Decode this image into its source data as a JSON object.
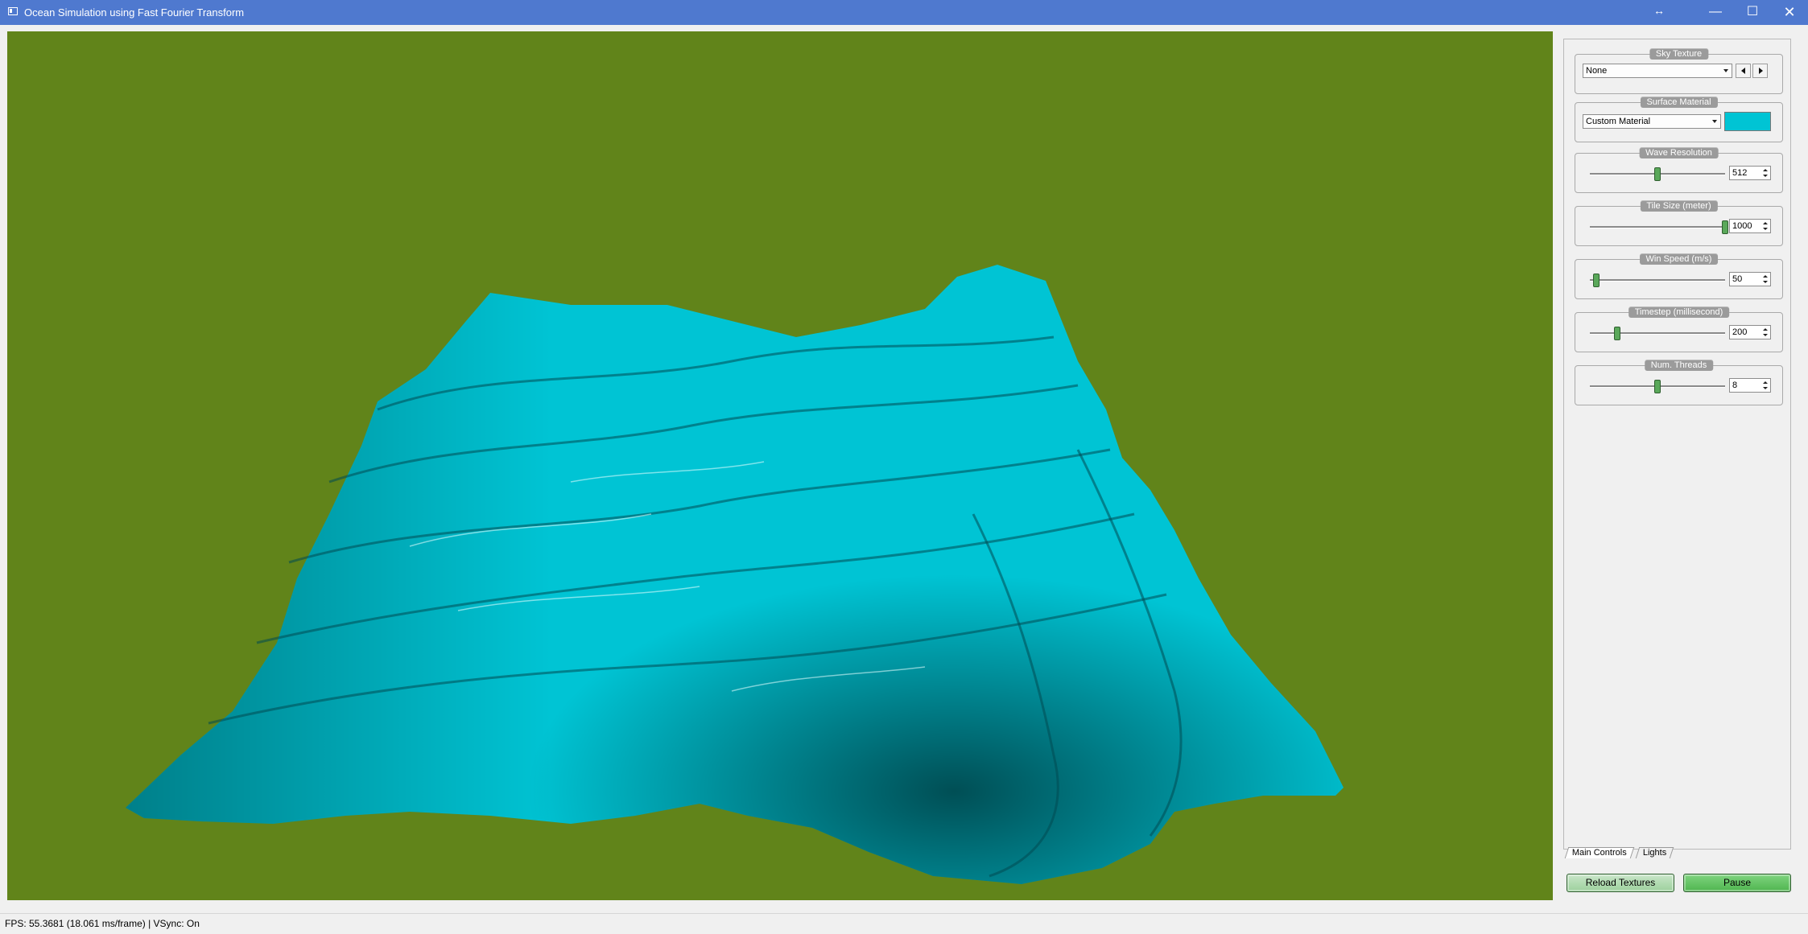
{
  "window": {
    "title": "Ocean Simulation using Fast Fourier Transform",
    "resize_glyph": "↔",
    "minimize_glyph": "—",
    "maximize_glyph": "☐",
    "close_glyph": "✕"
  },
  "viewport": {
    "background_color": "#61841a",
    "surface_color": "#00c4d4"
  },
  "panel": {
    "sky_texture": {
      "title": "Sky Texture",
      "value": "None"
    },
    "surface_material": {
      "title": "Surface Material",
      "value": "Custom Material",
      "color": "#00c4d4"
    },
    "wave_resolution": {
      "title": "Wave Resolution",
      "value": "512",
      "level": 0.5
    },
    "tile_size": {
      "title": "Tile Size (meter)",
      "value": "1000",
      "level": 1.0
    },
    "wind_speed": {
      "title": "Win Speed (m/s)",
      "value": "50",
      "level": 0.05
    },
    "timestep": {
      "title": "Timestep (millisecond)",
      "value": "200",
      "level": 0.2
    },
    "num_threads": {
      "title": "Num. Threads",
      "value": "8",
      "level": 0.5
    }
  },
  "tabs": [
    {
      "label": "Main Controls"
    },
    {
      "label": "Lights"
    }
  ],
  "buttons": {
    "reload_textures": "Reload Textures",
    "pause": "Pause"
  },
  "status": {
    "text": "FPS: 55.3681 (18.061 ms/frame) | VSync: On"
  }
}
